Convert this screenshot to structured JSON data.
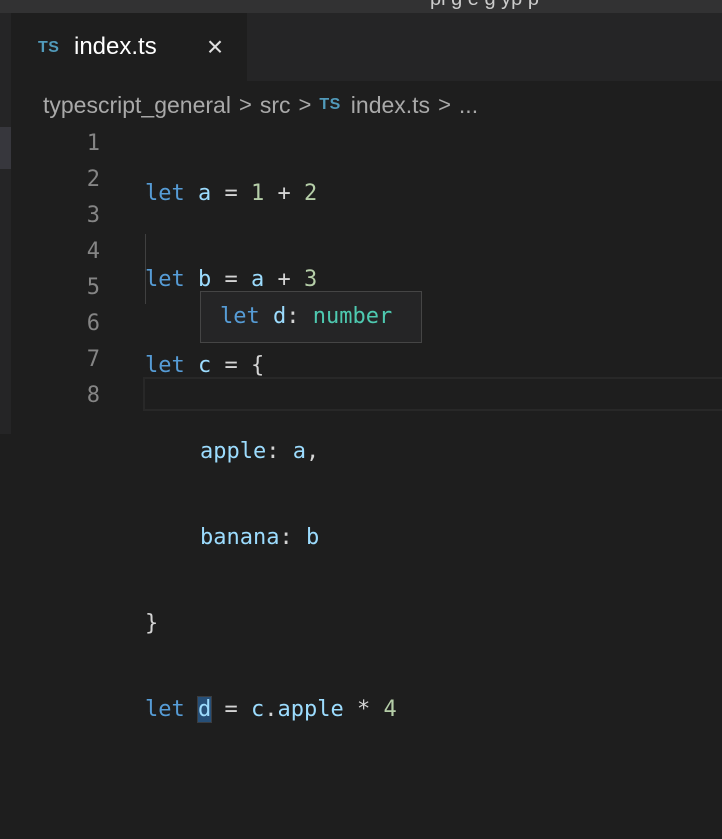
{
  "titlebar": {
    "text": "pl g e g yp p"
  },
  "tab": {
    "badge": "TS",
    "label": "index.ts",
    "close": "×"
  },
  "breadcrumb": {
    "items": [
      "typescript_general",
      "src",
      "index.ts",
      "..."
    ],
    "badge": "TS",
    "separator": ">"
  },
  "editor": {
    "line_numbers": [
      "1",
      "2",
      "3",
      "4",
      "5",
      "6",
      "7",
      "8"
    ],
    "lines": {
      "l1": {
        "kw": "let",
        "name": "a",
        "eq": " = ",
        "n1": "1",
        "op": " + ",
        "n2": "2"
      },
      "l2": {
        "kw": "let",
        "name": "b",
        "eq": " = ",
        "ref": "a",
        "op": " + ",
        "n": "3"
      },
      "l3": {
        "kw": "let",
        "name": "c",
        "rest": " = {"
      },
      "l4": {
        "prop": "apple",
        "colon": ": ",
        "val": "a",
        "comma": ","
      },
      "l5": {
        "prop": "banana",
        "colon": ": ",
        "val": "b"
      },
      "l6": {
        "text": "}"
      },
      "l7": {
        "kw": "let",
        "name": "d",
        "eq": " = ",
        "obj": "c",
        "dot": ".",
        "prop": "apple",
        "op": " * ",
        "n": "4"
      }
    }
  },
  "hover": {
    "kw": "let",
    "name": "d",
    "colon": ": ",
    "type": "number"
  },
  "colors": {
    "keyword": "#569cd6",
    "variable": "#9cdcfe",
    "number": "#b5cea8",
    "type": "#4ec9b0",
    "ts_badge": "#519aba"
  }
}
